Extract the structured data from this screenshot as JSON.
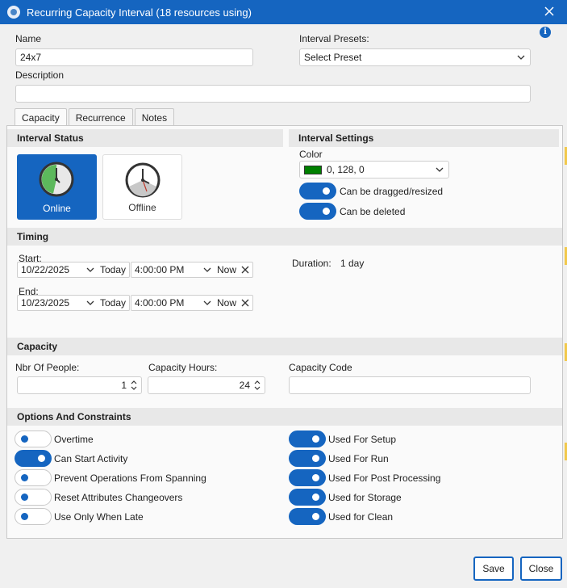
{
  "window": {
    "title": "Recurring Capacity Interval (18 resources using)"
  },
  "name": {
    "label": "Name",
    "value": "24x7"
  },
  "presets": {
    "label": "Interval Presets:",
    "value": "Select Preset"
  },
  "description": {
    "label": "Description",
    "value": ""
  },
  "tabs": [
    {
      "label": "Capacity",
      "active": true
    },
    {
      "label": "Recurrence",
      "active": false
    },
    {
      "label": "Notes",
      "active": false
    }
  ],
  "interval_status": {
    "header": "Interval Status",
    "online_label": "Online",
    "offline_label": "Offline",
    "selected": "Online"
  },
  "interval_settings": {
    "header": "Interval Settings",
    "color_label": "Color",
    "color_value": "0, 128, 0",
    "color_hex": "#008000",
    "draggable_label": "Can be dragged/resized",
    "draggable_on": true,
    "deletable_label": "Can be deleted",
    "deletable_on": true
  },
  "timing": {
    "header": "Timing",
    "start_label": "Start:",
    "start_date": "10/22/2025",
    "start_time": "4:00:00 PM",
    "end_label": "End:",
    "end_date": "10/23/2025",
    "end_time": "4:00:00 PM",
    "today_label": "Today",
    "now_label": "Now",
    "duration_label": "Duration:",
    "duration_value": "1 day"
  },
  "capacity": {
    "header": "Capacity",
    "people_label": "Nbr Of People:",
    "people_value": "1",
    "hours_label": "Capacity Hours:",
    "hours_value": "24",
    "code_label": "Capacity Code",
    "code_value": ""
  },
  "options": {
    "header": "Options And Constraints",
    "left": [
      {
        "label": "Overtime",
        "on": false
      },
      {
        "label": "Can Start Activity",
        "on": true
      },
      {
        "label": "Prevent Operations From Spanning",
        "on": false
      },
      {
        "label": "Reset Attributes Changeovers",
        "on": false
      },
      {
        "label": "Use Only When Late",
        "on": false
      }
    ],
    "right": [
      {
        "label": "Used For Setup",
        "on": true
      },
      {
        "label": "Used For Run",
        "on": true
      },
      {
        "label": "Used For Post Processing",
        "on": true
      },
      {
        "label": "Used for Storage",
        "on": true
      },
      {
        "label": "Used for Clean",
        "on": true
      }
    ]
  },
  "footer": {
    "save_label": "Save",
    "close_label": "Close"
  },
  "colors": {
    "accent": "#1565c0",
    "header_bg": "#e8e8e8",
    "panel_bg": "#fafafa"
  }
}
